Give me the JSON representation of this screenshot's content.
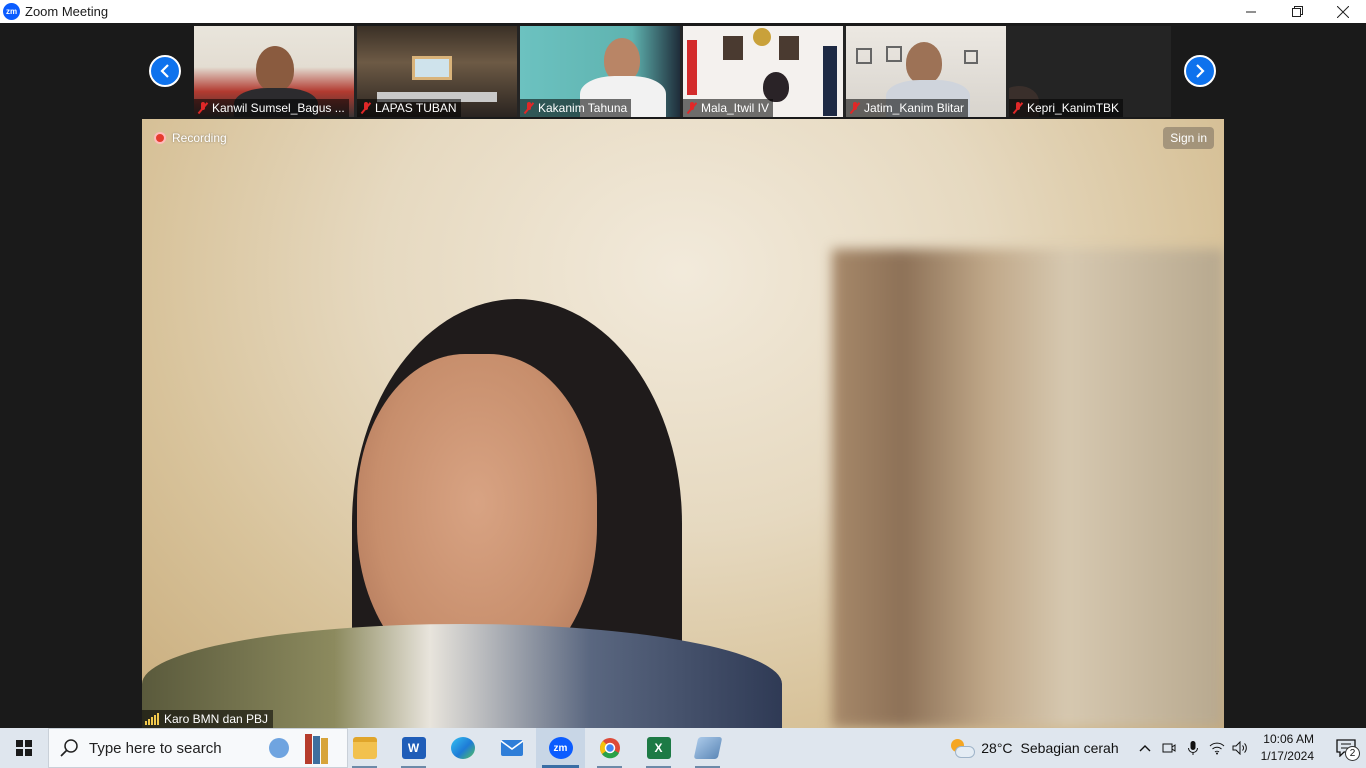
{
  "window": {
    "title": "Zoom Meeting",
    "app_icon_text": "zm",
    "controls": [
      "minimize",
      "restore",
      "close"
    ]
  },
  "meeting": {
    "participants": [
      {
        "name": "Kanwil Sumsel_Bagus ...",
        "muted": true
      },
      {
        "name": "LAPAS TUBAN",
        "muted": true
      },
      {
        "name": "Kakanim Tahuna",
        "muted": true
      },
      {
        "name": "Mala_Itwil IV",
        "muted": true
      },
      {
        "name": "Jatim_Kanim Blitar",
        "muted": true
      },
      {
        "name": "Kepri_KanimTBK",
        "muted": true
      }
    ],
    "recording_label": "Recording",
    "sign_in_label": "Sign in",
    "active_speaker": "Karo BMN dan PBJ"
  },
  "taskbar": {
    "search_placeholder": "Type here to search",
    "apps": [
      {
        "name": "File Explorer",
        "icon": "folder-icon"
      },
      {
        "name": "Word",
        "icon": "word-icon",
        "letter": "W"
      },
      {
        "name": "Edge",
        "icon": "edge-icon"
      },
      {
        "name": "Mail",
        "icon": "mail-icon"
      },
      {
        "name": "Zoom",
        "icon": "zoom-icon",
        "letter": "zm",
        "active": true
      },
      {
        "name": "Chrome",
        "icon": "chrome-icon"
      },
      {
        "name": "Excel",
        "icon": "excel-icon",
        "letter": "X"
      },
      {
        "name": "Other app",
        "icon": "app-icon"
      }
    ],
    "weather": {
      "temp": "28°C",
      "condition": "Sebagian cerah"
    },
    "clock": {
      "time": "10:06 AM",
      "date": "1/17/2024"
    },
    "notification_count": "2"
  }
}
